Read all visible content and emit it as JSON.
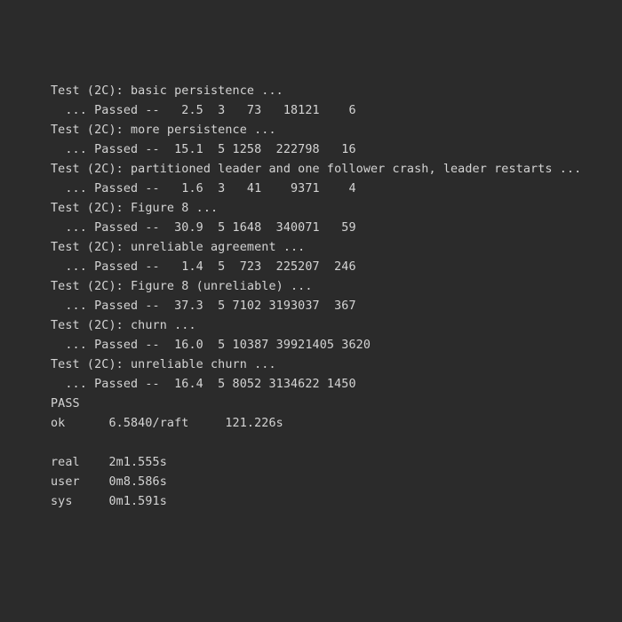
{
  "terminal": {
    "background_color": "#2b2b2b",
    "foreground_color": "#d4d4d4",
    "test_suite": "2C",
    "lines": [
      "Test (2C): basic persistence ...",
      "  ... Passed --   2.5  3   73   18121    6",
      "Test (2C): more persistence ...",
      "  ... Passed --  15.1  5 1258  222798   16",
      "Test (2C): partitioned leader and one follower crash, leader restarts ...",
      "  ... Passed --   1.6  3   41    9371    4",
      "Test (2C): Figure 8 ...",
      "  ... Passed --  30.9  5 1648  340071   59",
      "Test (2C): unreliable agreement ...",
      "  ... Passed --   1.4  5  723  225207  246",
      "Test (2C): Figure 8 (unreliable) ...",
      "  ... Passed --  37.3  5 7102 3193037  367",
      "Test (2C): churn ...",
      "  ... Passed --  16.0  5 10387 39921405 3620",
      "Test (2C): unreliable churn ...",
      "  ... Passed --  16.4  5 8052 3134622 1450",
      "PASS",
      "ok      6.5840/raft     121.226s",
      "",
      "real    2m1.555s",
      "user    0m8.586s",
      "sys     0m1.591s"
    ],
    "tests": [
      {
        "header": "Test (2C): basic persistence ...",
        "name": "basic persistence",
        "status": "Passed",
        "result_line": "  ... Passed --   2.5  3   73   18121    6",
        "time_seconds": "2.5",
        "peers": "3",
        "rpcs": "73",
        "bytes": "18121",
        "commits": "6"
      },
      {
        "header": "Test (2C): more persistence ...",
        "name": "more persistence",
        "status": "Passed",
        "result_line": "  ... Passed --  15.1  5 1258  222798   16",
        "time_seconds": "15.1",
        "peers": "5",
        "rpcs": "1258",
        "bytes": "222798",
        "commits": "16"
      },
      {
        "header": "Test (2C): partitioned leader and one follower crash, leader restarts ...",
        "name": "partitioned leader and one follower crash, leader restarts",
        "status": "Passed",
        "result_line": "  ... Passed --   1.6  3   41    9371    4",
        "time_seconds": "1.6",
        "peers": "3",
        "rpcs": "41",
        "bytes": "9371",
        "commits": "4"
      },
      {
        "header": "Test (2C): Figure 8 ...",
        "name": "Figure 8",
        "status": "Passed",
        "result_line": "  ... Passed --  30.9  5 1648  340071   59",
        "time_seconds": "30.9",
        "peers": "5",
        "rpcs": "1648",
        "bytes": "340071",
        "commits": "59"
      },
      {
        "header": "Test (2C): unreliable agreement ...",
        "name": "unreliable agreement",
        "status": "Passed",
        "result_line": "  ... Passed --   1.4  5  723  225207  246",
        "time_seconds": "1.4",
        "peers": "5",
        "rpcs": "723",
        "bytes": "225207",
        "commits": "246"
      },
      {
        "header": "Test (2C): Figure 8 (unreliable) ...",
        "name": "Figure 8 (unreliable)",
        "status": "Passed",
        "result_line": "  ... Passed --  37.3  5 7102 3193037  367",
        "time_seconds": "37.3",
        "peers": "5",
        "rpcs": "7102",
        "bytes": "3193037",
        "commits": "367"
      },
      {
        "header": "Test (2C): churn ...",
        "name": "churn",
        "status": "Passed",
        "result_line": "  ... Passed --  16.0  5 10387 39921405 3620",
        "time_seconds": "16.0",
        "peers": "5",
        "rpcs": "10387",
        "bytes": "39921405",
        "commits": "3620"
      },
      {
        "header": "Test (2C): unreliable churn ...",
        "name": "unreliable churn",
        "status": "Passed",
        "result_line": "  ... Passed --  16.4  5 8052 3134622 1450",
        "time_seconds": "16.4",
        "peers": "5",
        "rpcs": "8052",
        "bytes": "3134622",
        "commits": "1450"
      }
    ],
    "summary": {
      "verdict": "PASS",
      "ok_status": "ok",
      "package": "6.5840/raft",
      "package_elapsed": "121.226s",
      "ok_line": "ok      6.5840/raft     121.226s"
    },
    "timing": {
      "real_label": "real",
      "real_value": "2m1.555s",
      "user_label": "user",
      "user_value": "0m8.586s",
      "sys_label": "sys",
      "sys_value": "0m1.591s",
      "real_line": "real    2m1.555s",
      "user_line": "user    0m8.586s",
      "sys_line": "sys     0m1.591s"
    }
  }
}
